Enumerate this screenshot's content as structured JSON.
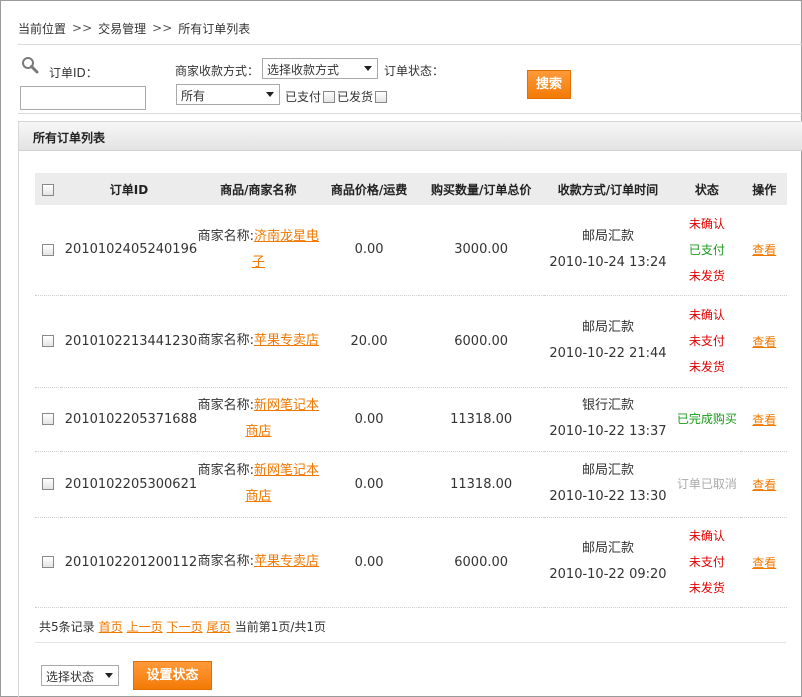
{
  "breadcrumb": {
    "items": [
      "当前位置",
      "交易管理",
      "所有订单列表"
    ],
    "separator": ">>"
  },
  "search": {
    "order_id_label": "订单ID：",
    "order_id_value": "",
    "pay_method_label": "商家收款方式：",
    "pay_method_selected": "选择收款方式",
    "order_status_label": "订单状态：",
    "status_selected": "所有",
    "paid_label": "已支付",
    "shipped_label": "已发货",
    "search_button": "搜索"
  },
  "panel": {
    "title": "所有订单列表"
  },
  "table": {
    "headers": [
      "订单ID",
      "商品/商家名称",
      "商品价格/运费",
      "购买数量/订单总价",
      "收款方式/订单时间",
      "状态",
      "操作"
    ],
    "merchant_prefix": "商家名称:",
    "rows": [
      {
        "id": "2010102405240196",
        "merchant_line1": "济南龙星电",
        "merchant_line2": "子",
        "price": "0.00",
        "total": "3000.00",
        "pay_method": "邮局汇款",
        "time": "2010-10-24 13:24",
        "status": [
          {
            "text": "未确认",
            "color": "red"
          },
          {
            "text": "已支付",
            "color": "green"
          },
          {
            "text": "未发货",
            "color": "red"
          }
        ],
        "action": "查看"
      },
      {
        "id": "2010102213441230",
        "merchant_line1": "苹果专卖店",
        "merchant_line2": "",
        "price": "20.00",
        "total": "6000.00",
        "pay_method": "邮局汇款",
        "time": "2010-10-22 21:44",
        "status": [
          {
            "text": "未确认",
            "color": "red"
          },
          {
            "text": "未支付",
            "color": "red"
          },
          {
            "text": "未发货",
            "color": "red"
          }
        ],
        "action": "查看"
      },
      {
        "id": "2010102205371688",
        "merchant_line1": "新网笔记本",
        "merchant_line2": "商店",
        "price": "0.00",
        "total": "11318.00",
        "pay_method": "银行汇款",
        "time": "2010-10-22 13:37",
        "status": [
          {
            "text": "已完成购买",
            "color": "green"
          }
        ],
        "action": "查看"
      },
      {
        "id": "2010102205300621",
        "merchant_line1": "新网笔记本",
        "merchant_line2": "商店",
        "price": "0.00",
        "total": "11318.00",
        "pay_method": "邮局汇款",
        "time": "2010-10-22 13:30",
        "status": [
          {
            "text": "订单已取消",
            "color": "grey"
          }
        ],
        "action": "查看"
      },
      {
        "id": "2010102201200112",
        "merchant_line1": "苹果专卖店",
        "merchant_line2": "",
        "price": "0.00",
        "total": "6000.00",
        "pay_method": "邮局汇款",
        "time": "2010-10-22 09:20",
        "status": [
          {
            "text": "未确认",
            "color": "red"
          },
          {
            "text": "未支付",
            "color": "red"
          },
          {
            "text": "未发货",
            "color": "red"
          }
        ],
        "action": "查看"
      }
    ]
  },
  "pager": {
    "summary": "共5条记录",
    "first": "首页",
    "prev": "上一页",
    "next": "下一页",
    "last": "尾页",
    "current": "当前第1页/共1页"
  },
  "bulk": {
    "status_select": "选择状态",
    "set_button": "设置状态"
  },
  "colors": {
    "accent": "#f07800",
    "red": "#e00000",
    "green": "#1a9a1a",
    "grey": "#aaaaaa"
  }
}
